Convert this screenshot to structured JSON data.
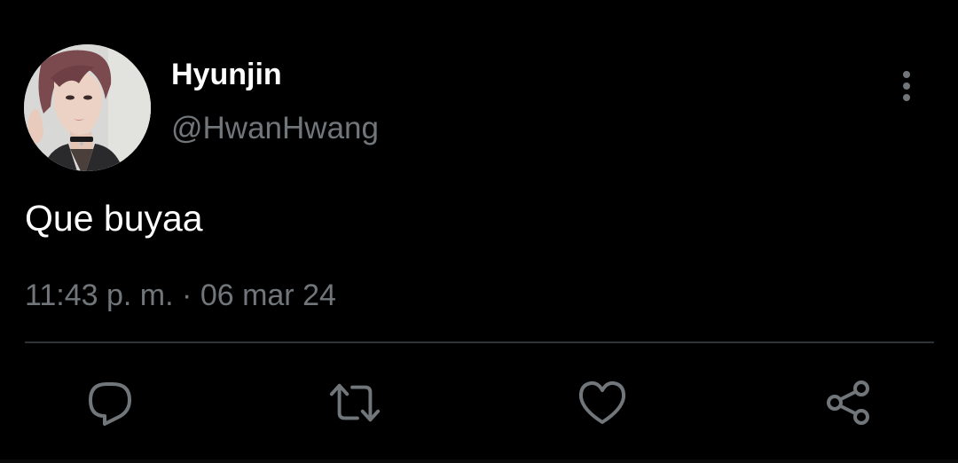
{
  "user": {
    "display_name": "Hyunjin",
    "handle": "@HwanHwang"
  },
  "tweet": {
    "text": "Que buyaa",
    "time": "11:43 p. m.",
    "separator": "·",
    "date": "06 mar 24"
  },
  "actions": {
    "reply_icon": "reply-icon",
    "retweet_icon": "retweet-icon",
    "like_icon": "heart-icon",
    "share_icon": "share-icon",
    "more_icon": "more-options-icon"
  },
  "colors": {
    "background": "#000000",
    "primary_text": "#ffffff",
    "secondary_text": "#71767b",
    "icon": "#71767b",
    "divider": "#2f3336"
  }
}
